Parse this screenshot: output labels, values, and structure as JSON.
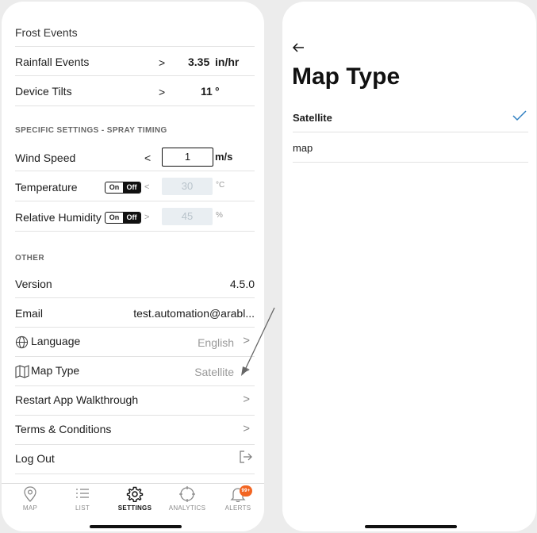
{
  "left": {
    "partial_row": {
      "label": "Frost Events"
    },
    "rows_top": [
      {
        "label": "Rainfall Events",
        "op": ">",
        "value": "3.35",
        "unit": "in/hr"
      },
      {
        "label": "Device Tilts",
        "op": ">",
        "value": "11",
        "unit": "°"
      }
    ],
    "spray_section": {
      "header": "SPECIFIC SETTINGS - SPRAY TIMING",
      "wind": {
        "label": "Wind Speed",
        "op": "<",
        "value": "1",
        "unit": "m/s"
      },
      "temperature": {
        "label": "Temperature",
        "toggle_on": "On",
        "toggle_off": "Off",
        "op": "<",
        "value": "30",
        "unit": "°C"
      },
      "humidity": {
        "label": "Relative Humidity",
        "toggle_on": "On",
        "toggle_off": "Off",
        "op": ">",
        "value": "45",
        "unit": "%"
      }
    },
    "other_section": {
      "header": "OTHER",
      "version": {
        "label": "Version",
        "value": "4.5.0"
      },
      "email": {
        "label": "Email",
        "value": "test.automation@arabl..."
      },
      "language": {
        "label": "Language",
        "value": "English",
        "icon": "globe-icon"
      },
      "map_type": {
        "label": "Map Type",
        "value": "Satellite",
        "icon": "map-icon"
      },
      "walkthrough": {
        "label": "Restart App Walkthrough"
      },
      "terms": {
        "label": "Terms & Conditions"
      },
      "logout": {
        "label": "Log Out",
        "icon": "logout-icon"
      }
    },
    "tabs": [
      {
        "label": "MAP",
        "icon": "location-pin-icon"
      },
      {
        "label": "LIST",
        "icon": "list-icon"
      },
      {
        "label": "SETTINGS",
        "icon": "gear-icon",
        "active": true
      },
      {
        "label": "ANALYTICS",
        "icon": "crosshair-icon"
      },
      {
        "label": "ALERTS",
        "icon": "bell-icon",
        "badge": "99+"
      }
    ],
    "badge_color": "#f26522"
  },
  "right": {
    "title": "Map Type",
    "options": [
      {
        "label": "Satellite",
        "selected": true
      },
      {
        "label": "map",
        "selected": false
      }
    ],
    "check_color": "#2f7fc1"
  }
}
